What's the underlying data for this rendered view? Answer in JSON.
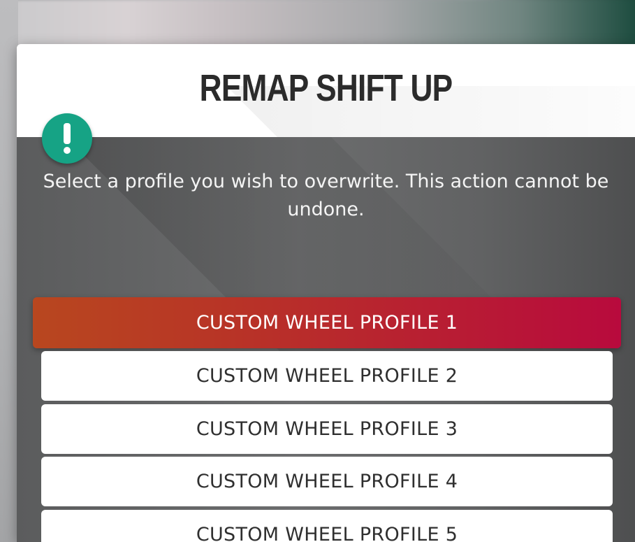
{
  "dialog": {
    "title": "REMAP SHIFT UP",
    "message": "Select a profile you wish to overwrite. This action cannot be undone.",
    "alert_icon": "exclamation-icon",
    "profiles": [
      {
        "label": "CUSTOM WHEEL PROFILE 1",
        "selected": true
      },
      {
        "label": "CUSTOM WHEEL PROFILE 2",
        "selected": false
      },
      {
        "label": "CUSTOM WHEEL PROFILE 3",
        "selected": false
      },
      {
        "label": "CUSTOM WHEEL PROFILE 4",
        "selected": false
      },
      {
        "label": "CUSTOM WHEEL PROFILE 5",
        "selected": false
      }
    ]
  },
  "colors": {
    "accent_start": "#b8471f",
    "accent_end": "#b80a3d",
    "alert_green": "#16a385"
  }
}
